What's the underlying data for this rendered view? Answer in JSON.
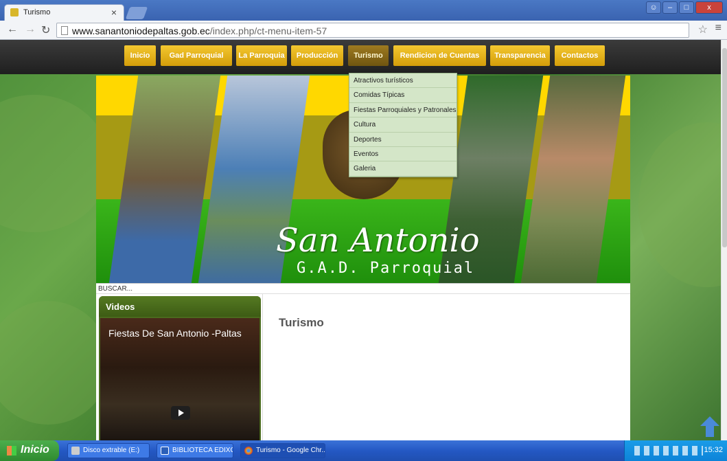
{
  "browser": {
    "tab_title": "Turismo",
    "url_host": "www.sanantoniodepaltas.gob.ec",
    "url_path": "/index.php/ct-menu-item-57"
  },
  "site": {
    "nav": [
      "Inicio",
      "Gad Parroquial",
      "La Parroquia",
      "Producción",
      "Turismo",
      "Rendicion de Cuentas",
      "Transparencia",
      "Contactos"
    ],
    "active_nav": "Turismo",
    "dropdown": [
      "Atractivos turísticos",
      "Comidas Típicas",
      "Fiestas Parroquiales y Patronales",
      "Cultura",
      "Deportes",
      "Eventos",
      "Galeria"
    ],
    "banner_title": "San Antonio",
    "banner_subtitle": "G.A.D. Parroquial",
    "search_placeholder": "BUSCAR...",
    "videos_heading": "Videos",
    "video_title": "Fiestas De San Antonio -Paltas",
    "article_title": "Turismo"
  },
  "taskbar": {
    "start_label": "Inicio",
    "buttons": [
      "Disco extrable (E:)",
      "BIBLIOTECA EDIXON ...",
      "Turismo - Google Chr..."
    ],
    "clock": "15:32"
  }
}
